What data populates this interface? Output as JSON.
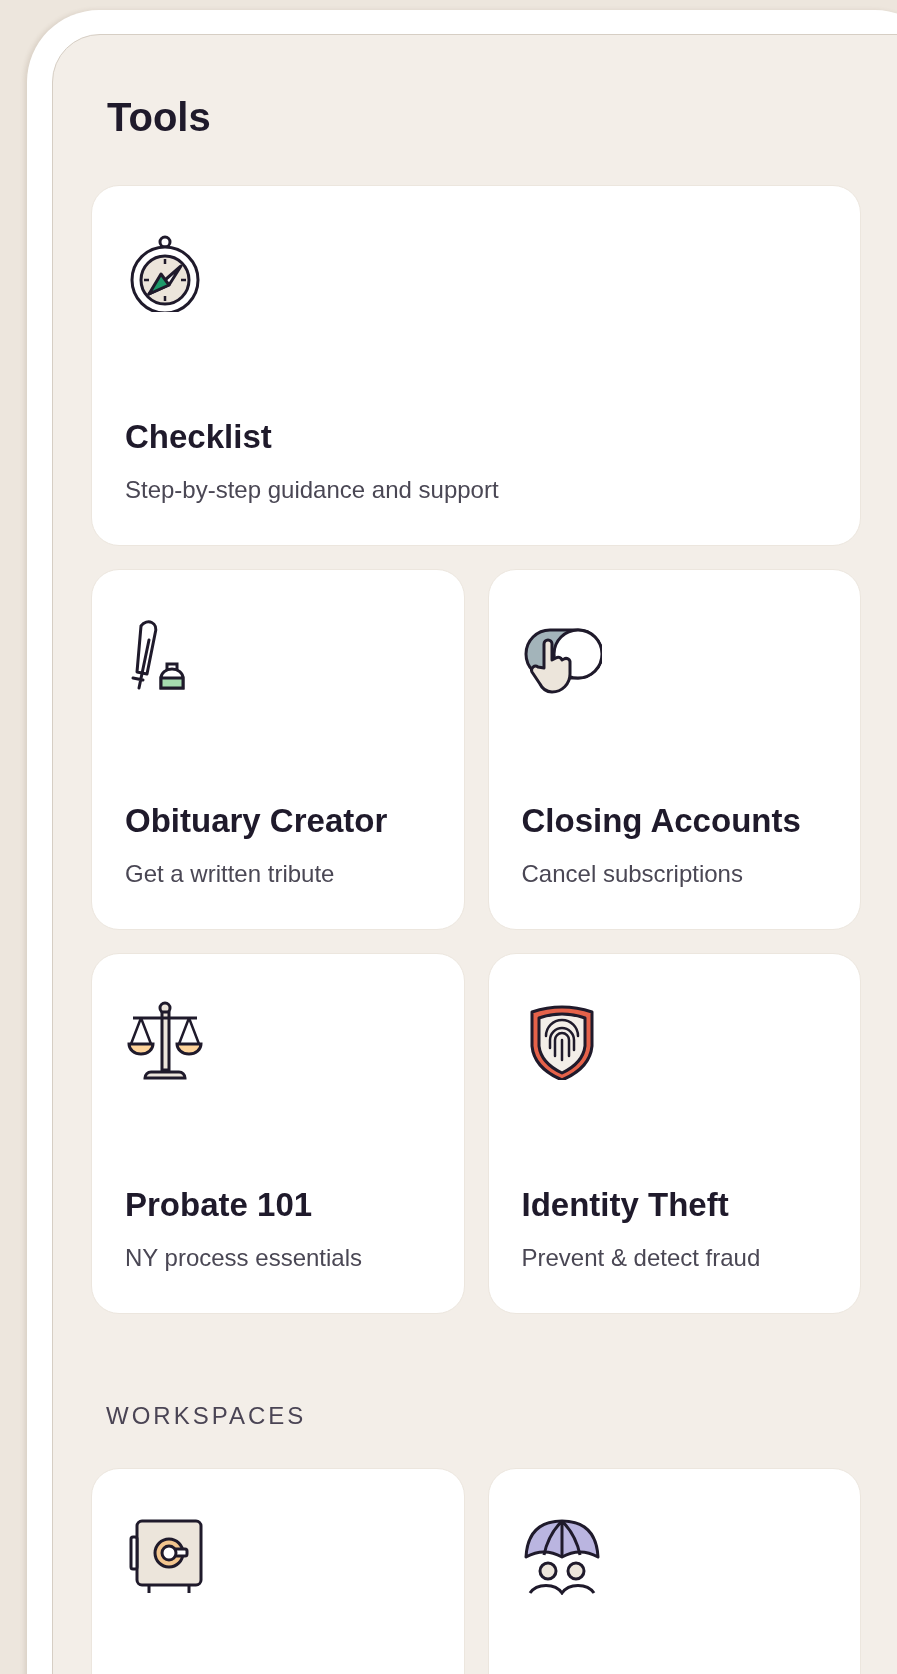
{
  "title": "Tools",
  "tools": [
    {
      "title": "Checklist",
      "description": "Step-by-step guidance and support"
    },
    {
      "title": "Obituary Creator",
      "description": "Get a written tribute"
    },
    {
      "title": "Closing Accounts",
      "description": "Cancel subscriptions"
    },
    {
      "title": "Probate 101",
      "description": "NY process essentials"
    },
    {
      "title": "Identity Theft",
      "description": "Prevent & detect fraud"
    }
  ],
  "workspaces_heading": "WORKSPACES"
}
